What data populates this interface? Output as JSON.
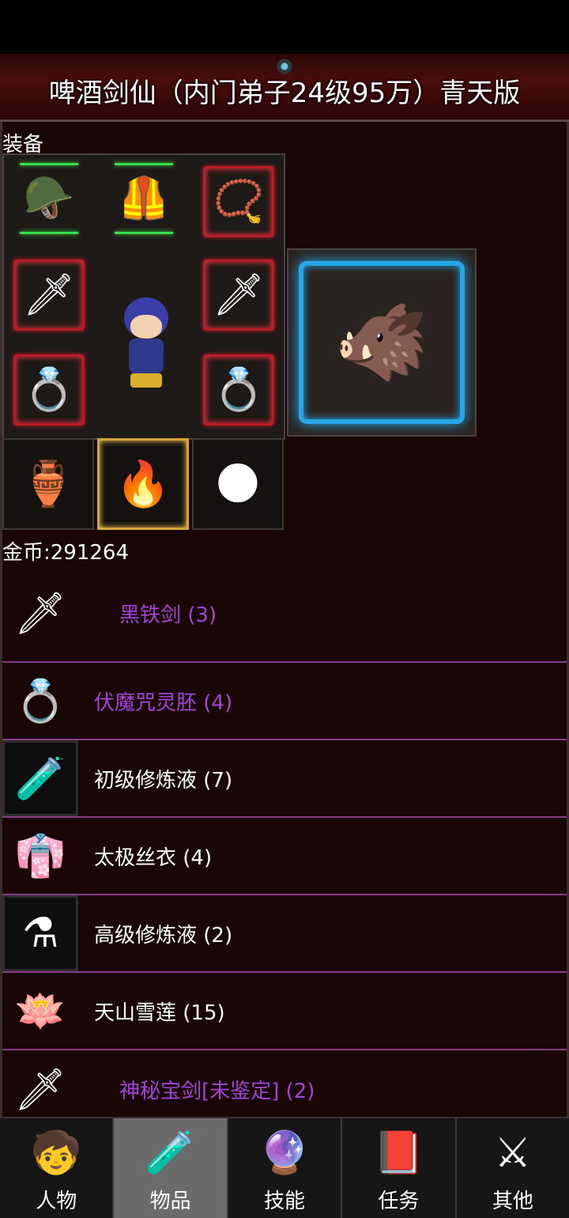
{
  "header": {
    "title": "啤酒剑仙（内门弟子24级95万）青天版"
  },
  "equipment": {
    "section_label": "装备",
    "slots": [
      {
        "name": "helmet",
        "icon": "helmet-icon",
        "glyph": "🪖"
      },
      {
        "name": "armor",
        "icon": "armor-icon",
        "glyph": "🦺"
      },
      {
        "name": "amulet",
        "icon": "amulet-icon",
        "glyph": "📿"
      },
      {
        "name": "sword-left",
        "icon": "sword-icon",
        "glyph": "🗡"
      },
      {
        "name": "sword-right",
        "icon": "sword-icon",
        "glyph": "🗡"
      },
      {
        "name": "ring-left",
        "icon": "ring-icon",
        "glyph": "💍"
      },
      {
        "name": "ring-right",
        "icon": "ring-icon",
        "glyph": "💍"
      },
      {
        "name": "bracer",
        "icon": "bracer-icon",
        "glyph": "🏺"
      },
      {
        "name": "talisman",
        "icon": "talisman-icon",
        "glyph": "🔥"
      },
      {
        "name": "pearl",
        "icon": "pearl-icon",
        "glyph": "🌑"
      }
    ],
    "mount_icon": "beast-mount-icon"
  },
  "gold": {
    "label": "金币:291264"
  },
  "inventory": [
    {
      "name": "黑铁剑 (3)",
      "color": "#a045d9",
      "icon": "iron-sword-icon",
      "glyph": "🗡"
    },
    {
      "name": "伏魔咒灵胚 (4)",
      "color": "#a045d9",
      "icon": "purple-ring-icon",
      "glyph": "💍"
    },
    {
      "name": "初级修炼液 (7)",
      "color": "#ffffff",
      "icon": "potion-vial-icon",
      "glyph": "🧪"
    },
    {
      "name": "太极丝衣 (4)",
      "color": "#ffffff",
      "icon": "silk-robe-icon",
      "glyph": "👘"
    },
    {
      "name": "高级修炼液 (2)",
      "color": "#ffffff",
      "icon": "potion-flask-icon",
      "glyph": "⚗"
    },
    {
      "name": "天山雪莲 (15)",
      "color": "#ffffff",
      "icon": "snow-lotus-icon",
      "glyph": "🪷"
    },
    {
      "name": "神秘宝剑[未鉴定] (2)",
      "color": "#a045d9",
      "icon": "mystery-sword-icon",
      "glyph": "🗡"
    }
  ],
  "nav": {
    "tabs": [
      {
        "label": "人物",
        "icon": "character-icon",
        "glyph": "🧒"
      },
      {
        "label": "物品",
        "icon": "items-icon",
        "glyph": "🧪"
      },
      {
        "label": "技能",
        "icon": "skills-icon",
        "glyph": "🔮"
      },
      {
        "label": "任务",
        "icon": "quests-icon",
        "glyph": "📕"
      },
      {
        "label": "其他",
        "icon": "other-icon",
        "glyph": "⚔"
      }
    ],
    "active": "物品"
  }
}
